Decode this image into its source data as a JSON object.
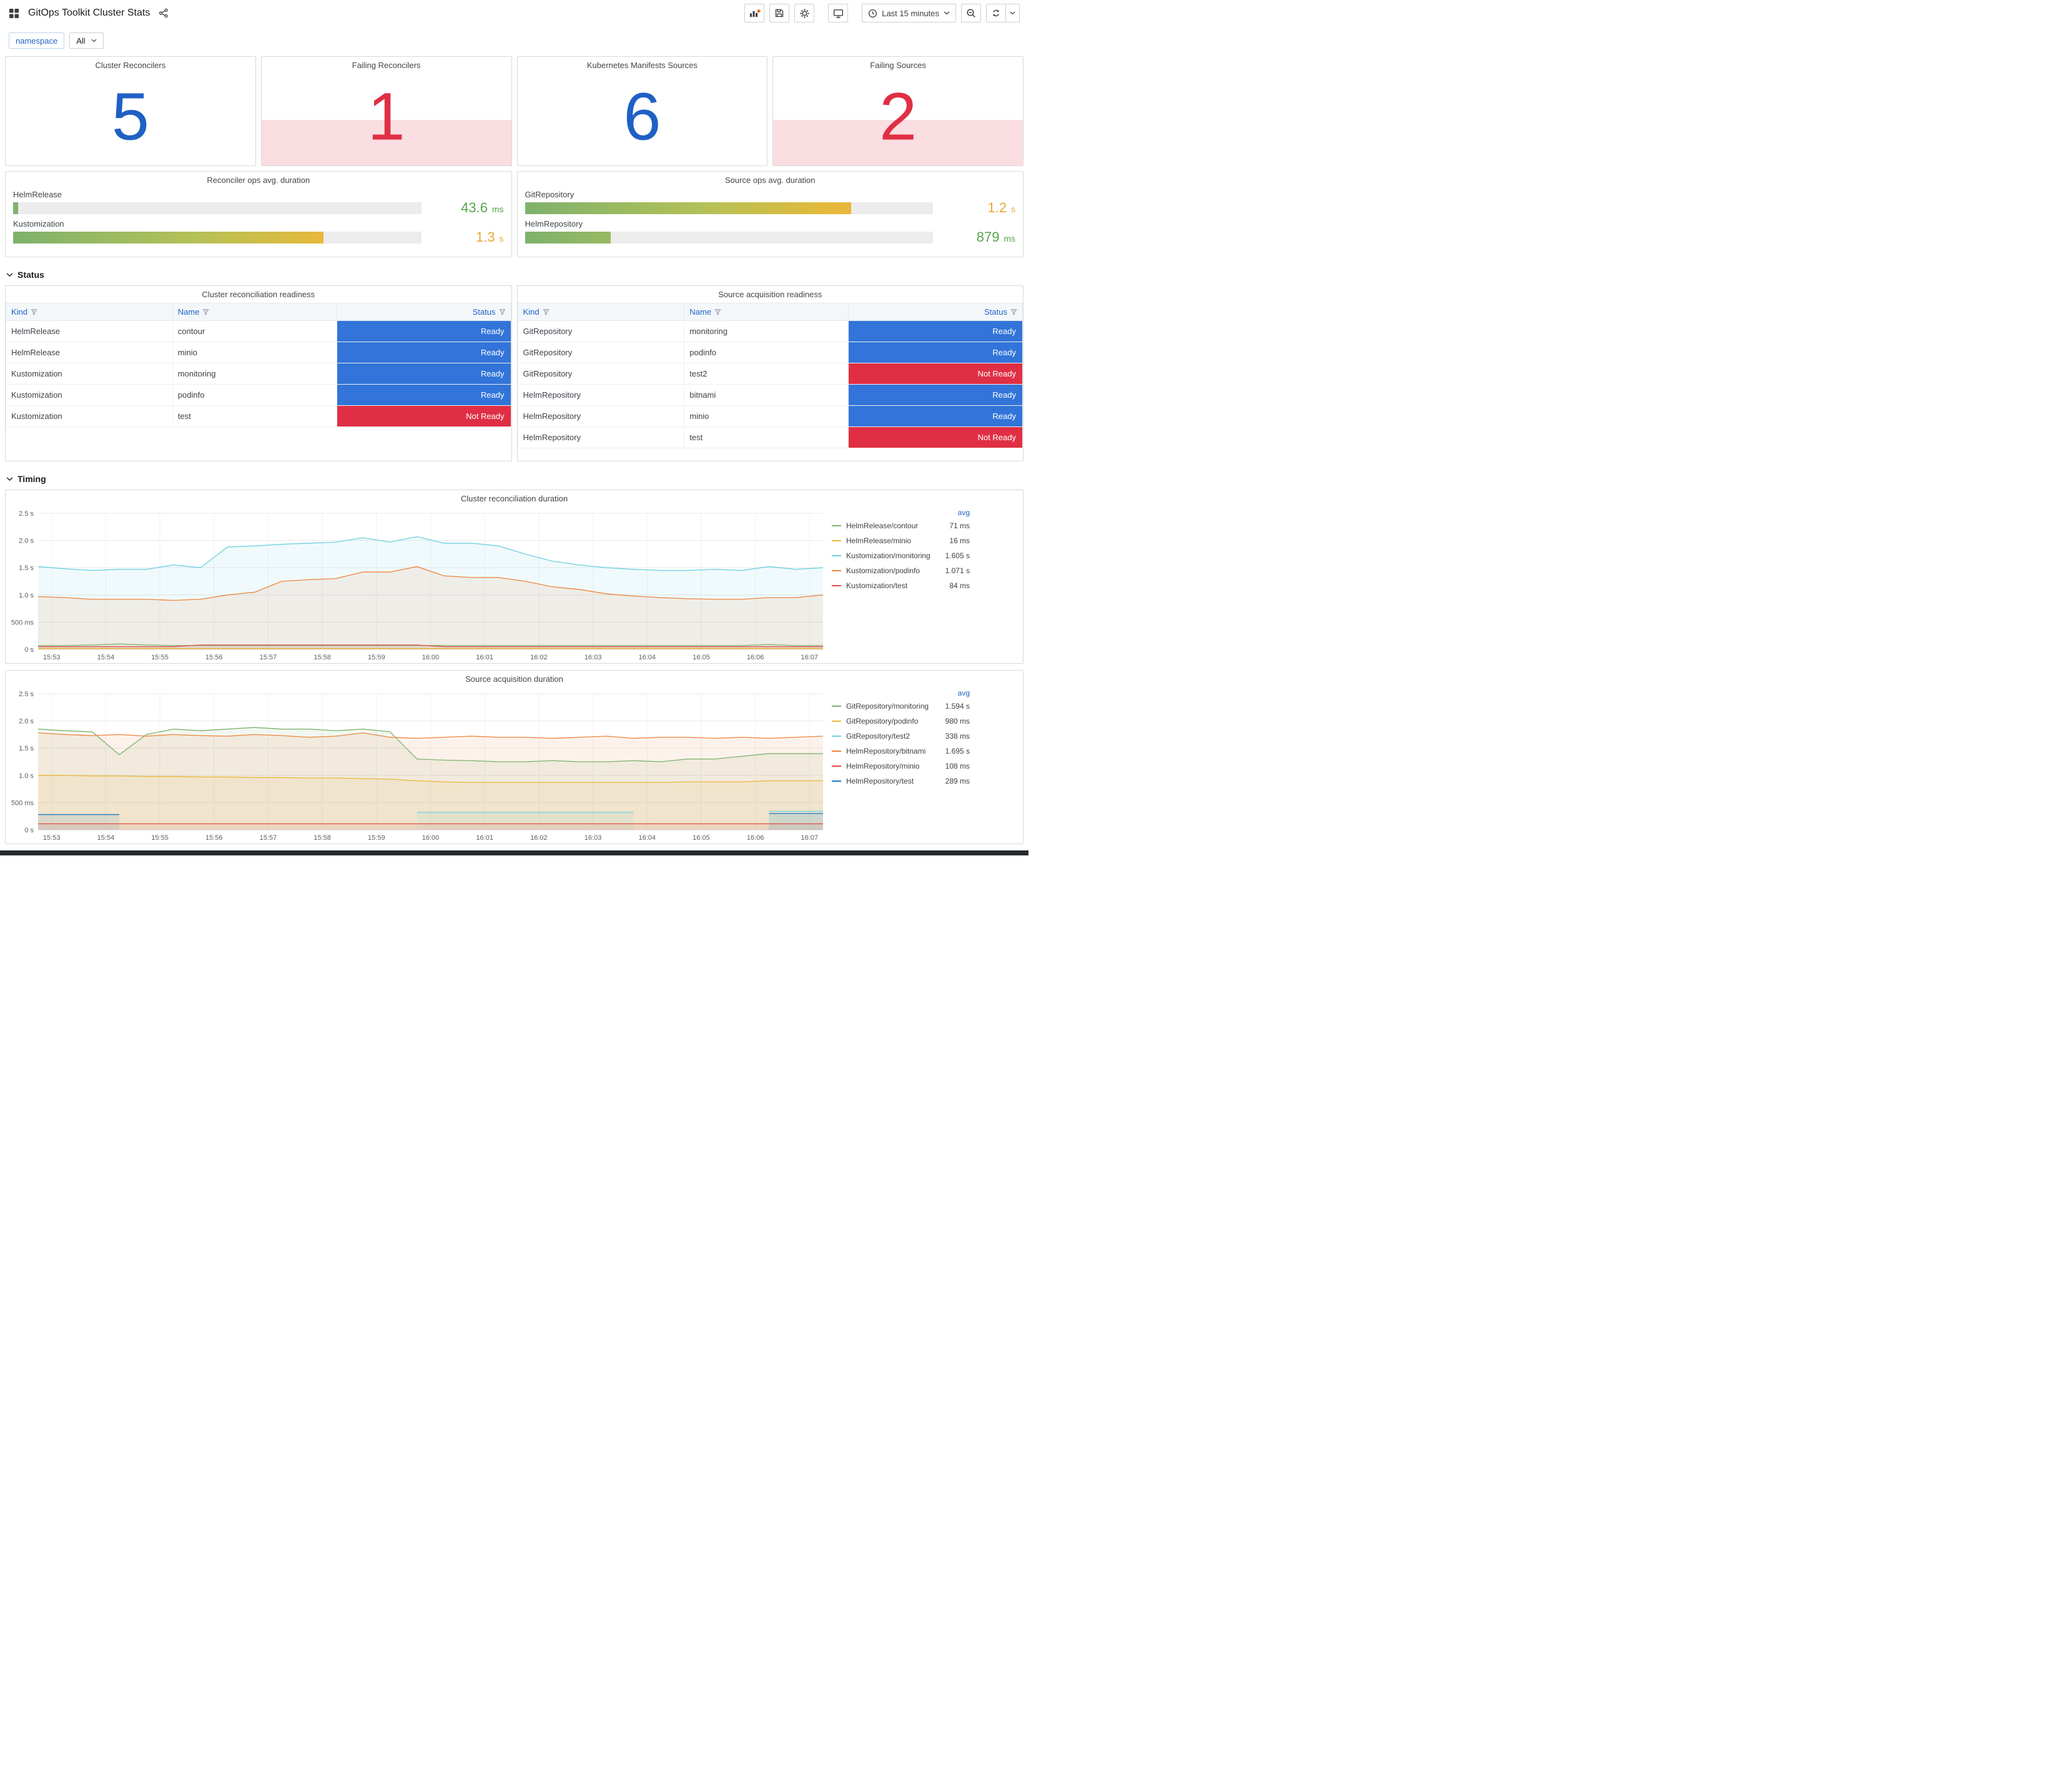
{
  "header": {
    "title": "GitOps Toolkit Cluster Stats",
    "time_range": "Last 15 minutes",
    "icons": {
      "left": [
        "dashboard-grid-icon",
        "share-icon"
      ],
      "right": [
        "add-panel-icon",
        "save-icon",
        "settings-gear-icon",
        "tv-icon",
        "clock-icon",
        "chevron-down-icon",
        "zoom-out-icon",
        "refresh-icon"
      ]
    }
  },
  "variables": {
    "label": "namespace",
    "value": "All"
  },
  "sections": {
    "status": "Status",
    "timing": "Timing"
  },
  "colors": {
    "stat_blue": "#1f60c4",
    "stat_red": "#e02f44",
    "ready": "#3274d9",
    "not_ready": "#e02f44",
    "header_link_blue": "#1f62c4"
  },
  "stats": [
    {
      "title": "Cluster Reconcilers",
      "value": "5",
      "state": "ok"
    },
    {
      "title": "Failing Reconcilers",
      "value": "1",
      "state": "alert"
    },
    {
      "title": "Kubernetes Manifests Sources",
      "value": "6",
      "state": "ok"
    },
    {
      "title": "Failing Sources",
      "value": "2",
      "state": "alert"
    }
  ],
  "gauges": [
    {
      "title": "Reconciler ops avg. duration",
      "bars": [
        {
          "label": "HelmRelease",
          "value": "43.6",
          "unit": "ms",
          "percent": 1.2,
          "value_color": "#56a64b"
        },
        {
          "label": "Kustomization",
          "value": "1.3",
          "unit": "s",
          "percent": 76,
          "value_color": "#e8a838"
        }
      ]
    },
    {
      "title": "Source ops avg. duration",
      "bars": [
        {
          "label": "GitRepository",
          "value": "1.2",
          "unit": "s",
          "percent": 80,
          "value_color": "#e8a838"
        },
        {
          "label": "HelmRepository",
          "value": "879",
          "unit": "ms",
          "percent": 21,
          "value_color": "#56a64b"
        }
      ]
    }
  ],
  "tables": [
    {
      "title": "Cluster reconciliation readiness",
      "columns": [
        "Kind",
        "Name",
        "Status"
      ],
      "rows": [
        [
          "HelmRelease",
          "contour",
          "Ready"
        ],
        [
          "HelmRelease",
          "minio",
          "Ready"
        ],
        [
          "Kustomization",
          "monitoring",
          "Ready"
        ],
        [
          "Kustomization",
          "podinfo",
          "Ready"
        ],
        [
          "Kustomization",
          "test",
          "Not Ready"
        ]
      ]
    },
    {
      "title": "Source acquisition readiness",
      "columns": [
        "Kind",
        "Name",
        "Status"
      ],
      "rows": [
        [
          "GitRepository",
          "monitoring",
          "Ready"
        ],
        [
          "GitRepository",
          "podinfo",
          "Ready"
        ],
        [
          "GitRepository",
          "test2",
          "Not Ready"
        ],
        [
          "HelmRepository",
          "bitnami",
          "Ready"
        ],
        [
          "HelmRepository",
          "minio",
          "Ready"
        ],
        [
          "HelmRepository",
          "test",
          "Not Ready"
        ]
      ]
    }
  ],
  "chart_data": [
    {
      "type": "line",
      "title": "Cluster reconciliation duration",
      "legend_header": "avg",
      "legend_position": "right",
      "grid": true,
      "ylim": [
        0,
        2.5
      ],
      "y_ticks": [
        "0 s",
        "500 ms",
        "1.0 s",
        "1.5 s",
        "2.0 s",
        "2.5 s"
      ],
      "y_tick_values": [
        0,
        0.5,
        1.0,
        1.5,
        2.0,
        2.5
      ],
      "x_ticks": [
        "15:53",
        "15:54",
        "15:55",
        "15:56",
        "15:57",
        "15:58",
        "15:59",
        "16:00",
        "16:01",
        "16:02",
        "16:03",
        "16:04",
        "16:05",
        "16:06",
        "16:07"
      ],
      "x_start": "15:52:45",
      "x_interval_s": 30,
      "x_first_tick_offset_s": 15,
      "series": [
        {
          "name": "HelmRelease/contour",
          "color": "#7EB26D",
          "avg": "71 ms",
          "values": [
            0.07,
            0.07,
            0.08,
            0.1,
            0.08,
            0.07,
            0.07,
            0.07,
            0.07,
            0.07,
            0.07,
            0.07,
            0.07,
            0.07,
            0.07,
            0.07,
            0.07,
            0.07,
            0.07,
            0.07,
            0.07,
            0.07,
            0.07,
            0.07,
            0.07,
            0.07,
            0.07,
            0.09,
            0.07,
            0.07
          ]
        },
        {
          "name": "HelmRelease/minio",
          "color": "#EAB839",
          "avg": "16 ms",
          "values": [
            0.016,
            0.016,
            0.016,
            0.016,
            0.016,
            0.016,
            0.016,
            0.016,
            0.016,
            0.016,
            0.016,
            0.016,
            0.016,
            0.016,
            0.016,
            0.016,
            0.016,
            0.016,
            0.016,
            0.016,
            0.016,
            0.016,
            0.016,
            0.016,
            0.016,
            0.016,
            0.016,
            0.016,
            0.016,
            0.016
          ]
        },
        {
          "name": "Kustomization/monitoring",
          "color": "#6ED0E0",
          "avg": "1.605 s",
          "values": [
            1.52,
            1.48,
            1.45,
            1.47,
            1.47,
            1.55,
            1.5,
            1.88,
            1.9,
            1.93,
            1.95,
            1.97,
            2.05,
            1.97,
            2.07,
            1.95,
            1.95,
            1.9,
            1.75,
            1.62,
            1.55,
            1.5,
            1.47,
            1.45,
            1.45,
            1.47,
            1.45,
            1.52,
            1.47,
            1.5
          ]
        },
        {
          "name": "Kustomization/podinfo",
          "color": "#EF843C",
          "avg": "1.071 s",
          "values": [
            0.97,
            0.95,
            0.92,
            0.92,
            0.92,
            0.9,
            0.92,
            1.0,
            1.05,
            1.25,
            1.28,
            1.3,
            1.42,
            1.42,
            1.52,
            1.35,
            1.32,
            1.32,
            1.25,
            1.15,
            1.1,
            1.02,
            0.98,
            0.95,
            0.93,
            0.92,
            0.92,
            0.95,
            0.95,
            1.0
          ]
        },
        {
          "name": "Kustomization/test",
          "color": "#E24D42",
          "avg": "84 ms",
          "values": [
            0.05,
            0.05,
            0.05,
            0.05,
            0.05,
            0.05,
            0.08,
            0.08,
            0.08,
            0.08,
            0.08,
            0.08,
            0.08,
            0.08,
            0.08,
            0.05,
            0.05,
            0.05,
            0.05,
            0.05,
            0.05,
            0.05,
            0.05,
            0.05,
            0.05,
            0.05,
            0.05,
            0.05,
            0.05,
            0.05
          ]
        }
      ]
    },
    {
      "type": "line",
      "title": "Source acquisition duration",
      "legend_header": "avg",
      "legend_position": "right",
      "grid": true,
      "ylim": [
        0,
        2.5
      ],
      "y_ticks": [
        "0 s",
        "500 ms",
        "1.0 s",
        "1.5 s",
        "2.0 s",
        "2.5 s"
      ],
      "y_tick_values": [
        0,
        0.5,
        1.0,
        1.5,
        2.0,
        2.5
      ],
      "x_ticks": [
        "15:53",
        "15:54",
        "15:55",
        "15:56",
        "15:57",
        "15:58",
        "15:59",
        "16:00",
        "16:01",
        "16:02",
        "16:03",
        "16:04",
        "16:05",
        "16:06",
        "16:07"
      ],
      "x_start": "15:52:45",
      "x_interval_s": 30,
      "x_first_tick_offset_s": 15,
      "series": [
        {
          "name": "GitRepository/monitoring",
          "color": "#7EB26D",
          "avg": "1.594 s",
          "values": [
            1.85,
            1.82,
            1.8,
            1.38,
            1.75,
            1.85,
            1.82,
            1.85,
            1.88,
            1.85,
            1.85,
            1.82,
            1.85,
            1.8,
            1.3,
            1.28,
            1.27,
            1.25,
            1.25,
            1.27,
            1.25,
            1.25,
            1.27,
            1.25,
            1.3,
            1.3,
            1.35,
            1.4,
            1.4,
            1.4
          ]
        },
        {
          "name": "GitRepository/podinfo",
          "color": "#EAB839",
          "avg": "980 ms",
          "values": [
            1.0,
            1.0,
            0.99,
            0.99,
            0.98,
            0.98,
            0.97,
            0.97,
            0.96,
            0.96,
            0.95,
            0.95,
            0.94,
            0.93,
            0.9,
            0.88,
            0.87,
            0.87,
            0.87,
            0.87,
            0.87,
            0.87,
            0.87,
            0.87,
            0.88,
            0.88,
            0.88,
            0.9,
            0.9,
            0.9
          ]
        },
        {
          "name": "GitRepository/test2",
          "color": "#6ED0E0",
          "avg": "338 ms",
          "values": [
            null,
            null,
            null,
            null,
            null,
            null,
            null,
            null,
            null,
            null,
            null,
            null,
            null,
            null,
            0.32,
            0.32,
            0.32,
            0.32,
            0.32,
            0.32,
            0.32,
            0.32,
            0.32,
            null,
            null,
            null,
            null,
            0.34,
            0.34,
            0.34
          ]
        },
        {
          "name": "HelmRepository/bitnami",
          "color": "#EF843C",
          "avg": "1.695 s",
          "values": [
            1.78,
            1.75,
            1.73,
            1.75,
            1.72,
            1.75,
            1.73,
            1.72,
            1.75,
            1.73,
            1.7,
            1.72,
            1.78,
            1.7,
            1.68,
            1.7,
            1.72,
            1.7,
            1.7,
            1.68,
            1.7,
            1.72,
            1.68,
            1.7,
            1.7,
            1.68,
            1.7,
            1.68,
            1.7,
            1.72
          ]
        },
        {
          "name": "HelmRepository/minio",
          "color": "#E24D42",
          "avg": "108 ms",
          "values": [
            0.11,
            0.11,
            0.11,
            0.11,
            0.11,
            0.11,
            0.11,
            0.11,
            0.11,
            0.11,
            0.11,
            0.11,
            0.11,
            0.11,
            0.11,
            0.11,
            0.11,
            0.11,
            0.11,
            0.11,
            0.11,
            0.11,
            0.11,
            0.11,
            0.11,
            0.11,
            0.11,
            0.11,
            0.11,
            0.11
          ]
        },
        {
          "name": "HelmRepository/test",
          "color": "#1F78C1",
          "avg": "289 ms",
          "values": [
            0.28,
            0.28,
            0.28,
            0.28,
            null,
            null,
            null,
            null,
            null,
            null,
            null,
            null,
            null,
            null,
            null,
            null,
            null,
            null,
            null,
            null,
            null,
            null,
            null,
            null,
            null,
            null,
            null,
            0.3,
            0.3,
            0.3
          ]
        }
      ]
    }
  ]
}
